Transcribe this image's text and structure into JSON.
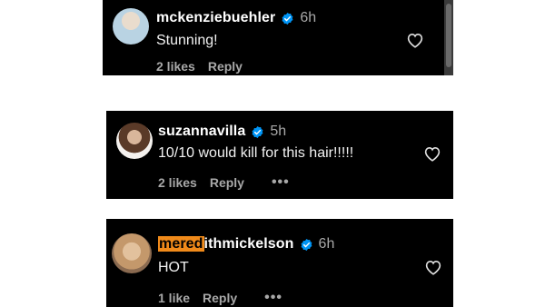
{
  "comments": [
    {
      "username_highlight": "",
      "username_rest": "mckenziebuehler",
      "time": "6h",
      "text": "Stunning!",
      "likes": "2 likes",
      "reply": "Reply",
      "more": ""
    },
    {
      "username_highlight": "",
      "username_rest": "suzannavilla",
      "time": "5h",
      "text": "10/10 would kill for this hair!!!!!",
      "likes": "2 likes",
      "reply": "Reply",
      "more": "•••"
    },
    {
      "username_highlight": "mered",
      "username_rest": "ithmickelson",
      "time": "6h",
      "text": "HOT",
      "likes": "1 like",
      "reply": "Reply",
      "more": "•••"
    }
  ],
  "colors": {
    "card_bg": "#000000",
    "verified_blue": "#0095f6",
    "highlight": "#f08a1a",
    "muted": "#a8a8a8"
  },
  "icons": {
    "verified": "verified-badge-icon",
    "heart": "heart-outline-icon",
    "more": "more-dots-icon"
  }
}
